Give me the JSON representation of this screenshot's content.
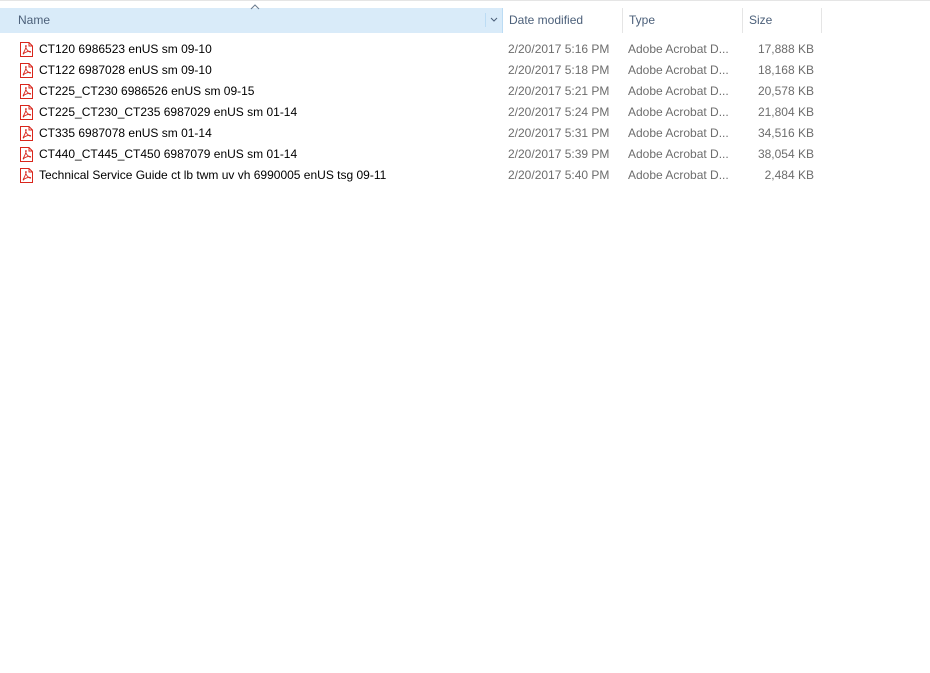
{
  "columns": {
    "name": "Name",
    "date_modified": "Date modified",
    "type": "Type",
    "size": "Size"
  },
  "colors": {
    "header_selected_bg": "#d9ebf9",
    "header_text": "#4c607a",
    "secondary_text": "#6d6d6d",
    "pdf_icon_red": "#d9261c"
  },
  "files": [
    {
      "name": "CT120 6986523 enUS sm 09-10",
      "date": "2/20/2017 5:16 PM",
      "type": "Adobe Acrobat D...",
      "size": "17,888 KB",
      "icon": "pdf-icon"
    },
    {
      "name": "CT122 6987028 enUS sm 09-10",
      "date": "2/20/2017 5:18 PM",
      "type": "Adobe Acrobat D...",
      "size": "18,168 KB",
      "icon": "pdf-icon"
    },
    {
      "name": "CT225_CT230 6986526 enUS sm 09-15",
      "date": "2/20/2017 5:21 PM",
      "type": "Adobe Acrobat D...",
      "size": "20,578 KB",
      "icon": "pdf-icon"
    },
    {
      "name": "CT225_CT230_CT235 6987029 enUS sm 01-14",
      "date": "2/20/2017 5:24 PM",
      "type": "Adobe Acrobat D...",
      "size": "21,804 KB",
      "icon": "pdf-icon"
    },
    {
      "name": "CT335 6987078 enUS sm 01-14",
      "date": "2/20/2017 5:31 PM",
      "type": "Adobe Acrobat D...",
      "size": "34,516 KB",
      "icon": "pdf-icon"
    },
    {
      "name": "CT440_CT445_CT450 6987079 enUS sm 01-14",
      "date": "2/20/2017 5:39 PM",
      "type": "Adobe Acrobat D...",
      "size": "38,054 KB",
      "icon": "pdf-icon"
    },
    {
      "name": "Technical Service Guide ct lb twm uv vh 6990005 enUS tsg 09-11",
      "date": "2/20/2017 5:40 PM",
      "type": "Adobe Acrobat D...",
      "size": "2,484 KB",
      "icon": "pdf-icon"
    }
  ]
}
